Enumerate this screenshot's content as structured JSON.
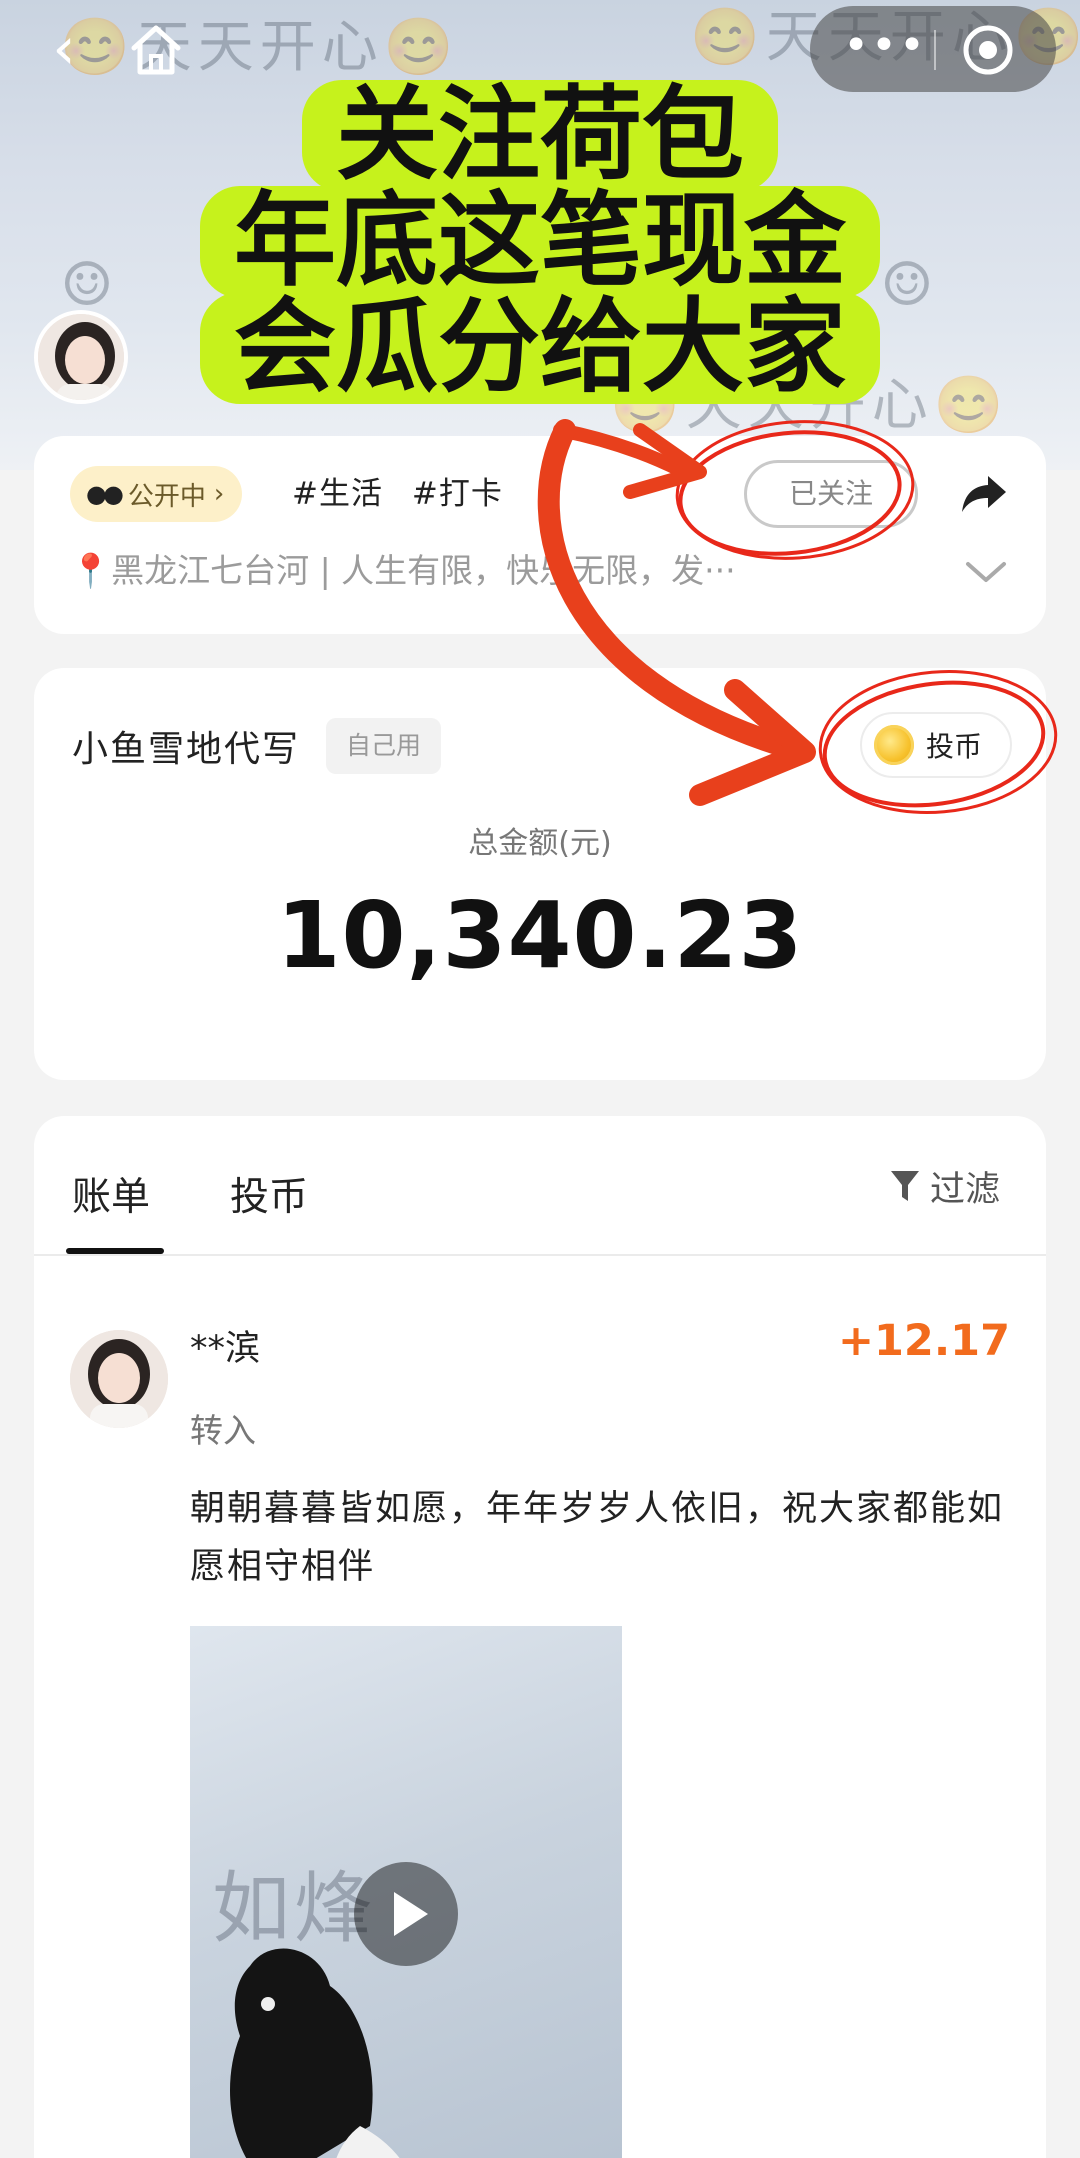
{
  "nav": {
    "back_icon": "chevron-left-icon",
    "home_icon": "home-icon",
    "more_label": "•••",
    "target_icon": "target-icon"
  },
  "banner": {
    "doodle_top": "😊天天开心😊",
    "doodle_bottom": "😊天天开心😊",
    "promo_lines": [
      "关注荷包",
      "年底这笔现金",
      "会瓜分给大家"
    ],
    "promo_color": "#c6f21c"
  },
  "info": {
    "status": "公开中",
    "tags": [
      "#生活",
      "#打卡"
    ],
    "follow_label": "已关注",
    "location": "📍黑龙江七台河 | 人生有限，快乐无限，发···"
  },
  "balance": {
    "owner": "小鱼雪地代写",
    "badge": "自己用",
    "coin_button": "投币",
    "total_label": "总金额(元)",
    "total_amount": "10,340.23"
  },
  "ledger": {
    "tabs": [
      "账单",
      "投币"
    ],
    "active_tab": "账单",
    "filter_label": "过滤",
    "transactions": [
      {
        "name": "**滨",
        "amount": "+12.17",
        "type": "转入",
        "message": "朝朝暮暮皆如愿，年年岁岁人依旧，祝大家都能如愿相守相伴",
        "video_snow_text": "如烽"
      }
    ]
  },
  "colors": {
    "accent_orange": "#f26b1d",
    "annotation_red": "#e8281a",
    "status_pill_bg": "#fdf0c9"
  }
}
